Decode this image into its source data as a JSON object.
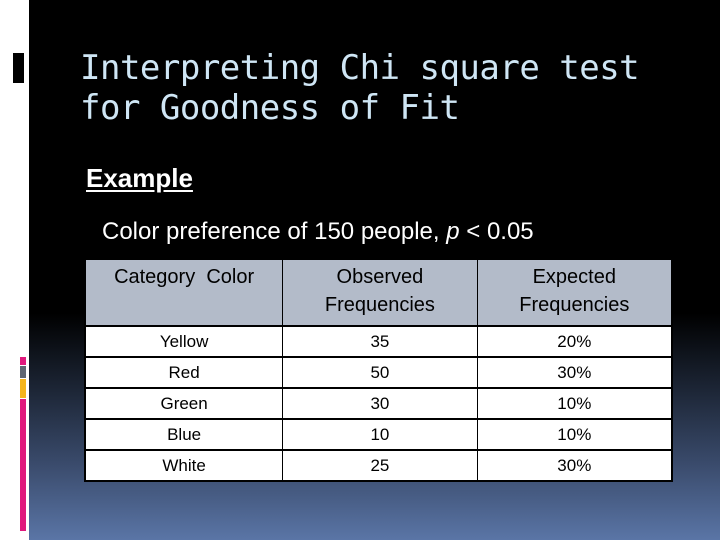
{
  "slide": {
    "title_lines": [
      "Interpreting Chi square test",
      "for Goodness of Fit"
    ],
    "section_heading": "Example",
    "subtitle": {
      "prefix": "Color preference of 150 people, ",
      "italic": "p",
      "suffix": " < 0.05"
    },
    "accent_colors": [
      "#e0197d",
      "#5f6672",
      "#f5b51b",
      "#e0197d"
    ]
  },
  "table": {
    "headers": [
      [
        "Category  Color"
      ],
      [
        "Observed",
        "Frequencies"
      ],
      [
        "Expected",
        "Frequencies"
      ]
    ],
    "rows": [
      {
        "color": "Yellow",
        "observed": "35",
        "expected": "20%"
      },
      {
        "color": "Red",
        "observed": "50",
        "expected": "30%"
      },
      {
        "color": "Green",
        "observed": "30",
        "expected": "10%"
      },
      {
        "color": "Blue",
        "observed": "10",
        "expected": "10%"
      },
      {
        "color": "White",
        "observed": "25",
        "expected": "30%"
      }
    ]
  }
}
